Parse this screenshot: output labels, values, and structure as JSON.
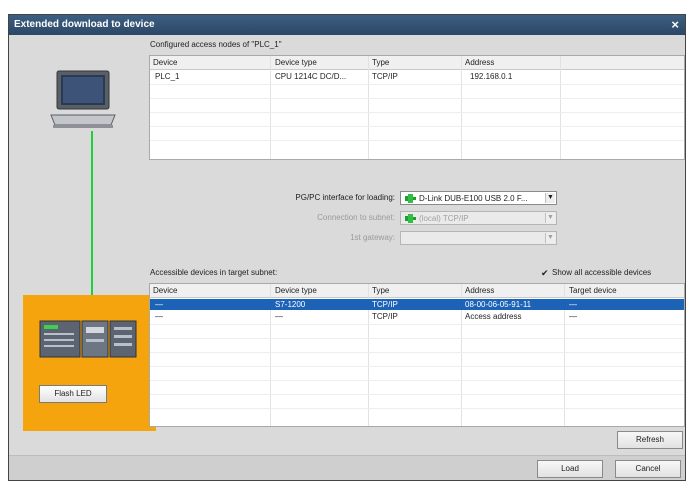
{
  "dialog": {
    "title": "Extended download to device",
    "close_glyph": "×"
  },
  "configured_nodes": {
    "label": "Configured access nodes of \"PLC_1\"",
    "columns": [
      "Device",
      "Device type",
      "Type",
      "Address"
    ],
    "rows": [
      {
        "device": "PLC_1",
        "device_type": "CPU 1214C DC/D...",
        "type": "TCP/IP",
        "address": "192.168.0.1"
      }
    ]
  },
  "interface": {
    "pgpc_label": "PG/PC interface for loading:",
    "pgpc_value": "D-Link DUB-E100 USB 2.0 F...",
    "subnet_label": "Connection to subnet:",
    "subnet_value": "(local) TCP/IP",
    "gateway_label": "1st gateway:",
    "gateway_value": ""
  },
  "accessible": {
    "label": "Accessible devices in target subnet:",
    "show_all_label": "Show all accessible devices",
    "show_all_checked": true,
    "columns": [
      "Device",
      "Device type",
      "Type",
      "Address",
      "Target device"
    ],
    "rows": [
      {
        "device": "—",
        "device_type": "S7-1200",
        "type": "TCP/IP",
        "address": "08-00-06-05-91-11",
        "target": "—",
        "selected": true
      },
      {
        "device": "—",
        "device_type": "—",
        "type": "TCP/IP",
        "address": "Access address",
        "target": "—",
        "selected": false
      }
    ]
  },
  "left_panel": {
    "flash_led_label": "Flash LED",
    "link_color": "#1fcf3b",
    "panel_color": "#f5a40d"
  },
  "buttons": {
    "refresh": "Refresh",
    "load": "Load",
    "cancel": "Cancel"
  },
  "colors": {
    "title_bar": "#2c4766",
    "selection": "#1c63b8"
  }
}
